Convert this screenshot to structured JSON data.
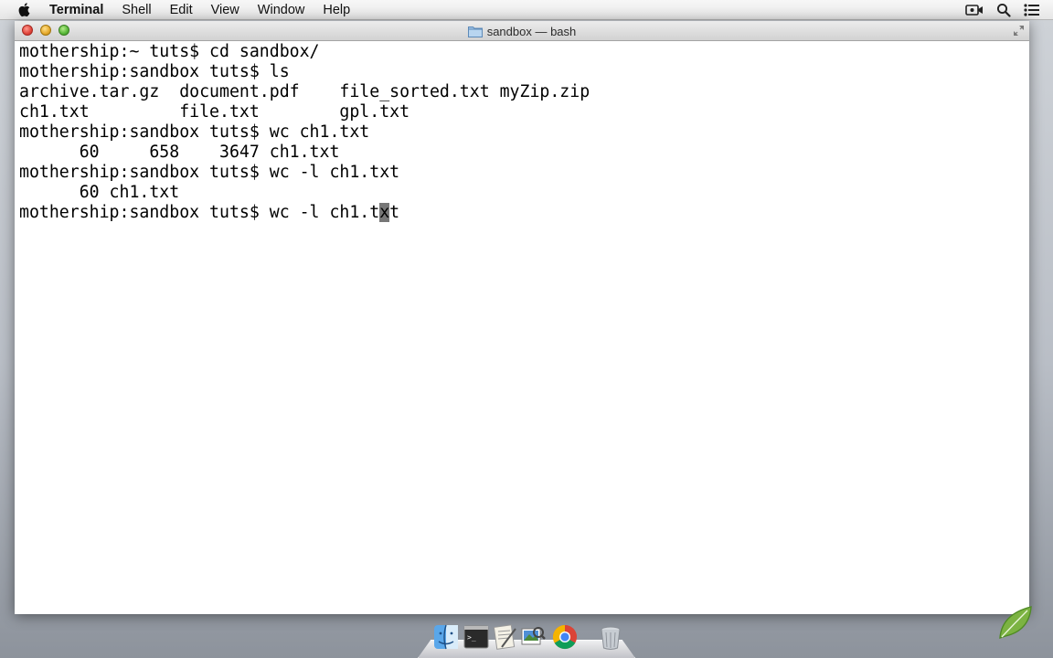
{
  "menubar": {
    "apple_icon": "apple-icon",
    "app_name": "Terminal",
    "items": [
      "Shell",
      "Edit",
      "View",
      "Window",
      "Help"
    ],
    "status_icons": [
      "facetime-camera-icon",
      "spotlight-search-icon",
      "notification-center-icon"
    ]
  },
  "window": {
    "title": "sandbox — bash",
    "title_icon": "folder-icon",
    "colors": {
      "close": "#e0443a",
      "minimize": "#e5a82a",
      "zoom": "#55b637"
    }
  },
  "terminal": {
    "lines": [
      "mothership:~ tuts$ cd sandbox/",
      "mothership:sandbox tuts$ ls",
      "archive.tar.gz  document.pdf    file_sorted.txt myZip.zip",
      "ch1.txt         file.txt        gpl.txt",
      "mothership:sandbox tuts$ wc ch1.txt",
      "      60     658    3647 ch1.txt",
      "mothership:sandbox tuts$ wc -l ch1.txt",
      "      60 ch1.txt"
    ],
    "current_line_before_cursor": "mothership:sandbox tuts$ wc -l ch1.t",
    "cursor_char": "x",
    "current_line_after_cursor": "t"
  },
  "dock": {
    "items": [
      {
        "name": "finder",
        "icon": "finder-icon"
      },
      {
        "name": "terminal",
        "icon": "terminal-icon"
      },
      {
        "name": "textedit",
        "icon": "textedit-icon"
      },
      {
        "name": "preview",
        "icon": "preview-icon"
      },
      {
        "name": "chrome",
        "icon": "chrome-icon"
      },
      {
        "name": "trash",
        "icon": "trash-icon"
      }
    ]
  }
}
